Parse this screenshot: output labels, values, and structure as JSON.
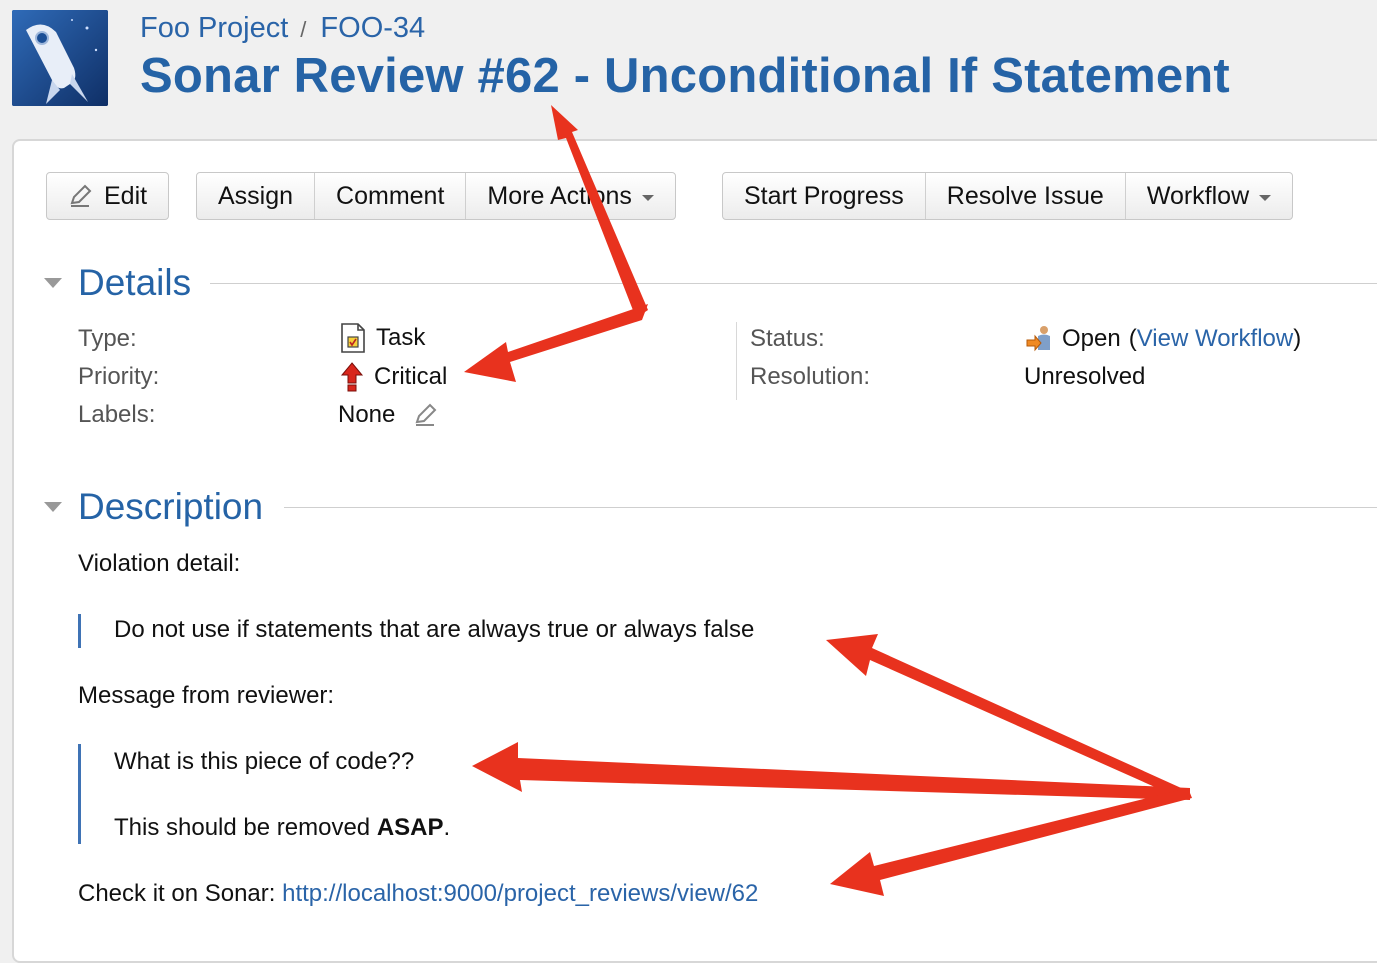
{
  "header": {
    "project": "Foo Project",
    "separator": "/",
    "issue_key": "FOO-34",
    "title": "Sonar Review #62 - Unconditional If Statement"
  },
  "toolbar": {
    "edit": "Edit",
    "assign": "Assign",
    "comment": "Comment",
    "more_actions": "More Actions",
    "start_progress": "Start Progress",
    "resolve_issue": "Resolve Issue",
    "workflow": "Workflow"
  },
  "details": {
    "heading": "Details",
    "type_label": "Type:",
    "type_value": "Task",
    "priority_label": "Priority:",
    "priority_value": "Critical",
    "labels_label": "Labels:",
    "labels_value": "None",
    "status_label": "Status:",
    "status_value": "Open",
    "paren_open": "(",
    "view_workflow": "View Workflow",
    "paren_close": ")",
    "resolution_label": "Resolution:",
    "resolution_value": "Unresolved"
  },
  "description": {
    "heading": "Description",
    "violation_label": "Violation detail:",
    "violation_quote": "Do not use if statements that are always true or always false",
    "reviewer_label": "Message from reviewer:",
    "reviewer_line1": "What is this piece of code??",
    "reviewer_line2_prefix": "This should be removed ",
    "reviewer_line2_bold": "ASAP",
    "reviewer_line2_suffix": ".",
    "sonar_prefix": "Check it on Sonar: ",
    "sonar_link": "http://localhost:9000/project_reviews/view/62"
  },
  "colors": {
    "brand_blue": "#2563a6",
    "link_blue": "#2a64a8",
    "annotation_red": "#e8321e"
  },
  "icons": {
    "logo": "rocket-logo-icon",
    "edit": "pencil-icon",
    "task": "task-icon",
    "priority": "critical-priority-arrow-icon",
    "status": "open-status-icon"
  }
}
